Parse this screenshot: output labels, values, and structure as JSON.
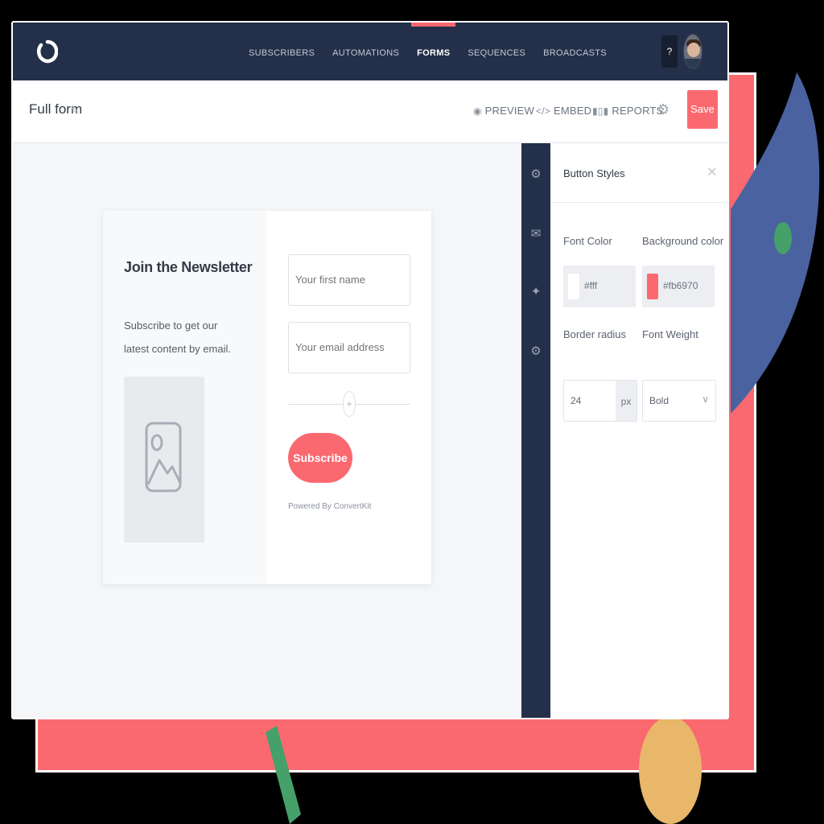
{
  "colors": {
    "nav_bg": "#243049",
    "accent": "#fb6970",
    "page_bg": "#f4f6f8"
  },
  "nav": {
    "logo_icon": "convertkit-logo-icon",
    "items": [
      {
        "label": "SUBSCRIBERS",
        "active": false
      },
      {
        "label": "AUTOMATIONS",
        "active": false
      },
      {
        "label": "FORMS",
        "active": true
      },
      {
        "label": "SEQUENCES",
        "active": false
      },
      {
        "label": "BROADCASTS",
        "active": false
      }
    ],
    "help_label": "?"
  },
  "toolbar": {
    "form_title": "Full form",
    "preview_label": "PREVIEW",
    "embed_label": "EMBED",
    "reports_label": "REPORTS",
    "save_label": "Save"
  },
  "form_preview": {
    "title": "Join the Newsletter",
    "description": "Subscribe to get our latest content by email.",
    "first_name_placeholder": "Your first name",
    "email_placeholder": "Your email address",
    "button_label": "Subscribe",
    "powered_by": "Powered By ConvertKit"
  },
  "panel": {
    "title": "Button Styles",
    "font_color_label": "Font Color",
    "font_color_value": "#fff",
    "background_color_label": "Background color",
    "background_color_value": "#fb6970",
    "border_radius_label": "Border radius",
    "border_radius_value": "24",
    "border_radius_unit": "px",
    "font_weight_label": "Font Weight",
    "font_weight_value": "Bold"
  }
}
